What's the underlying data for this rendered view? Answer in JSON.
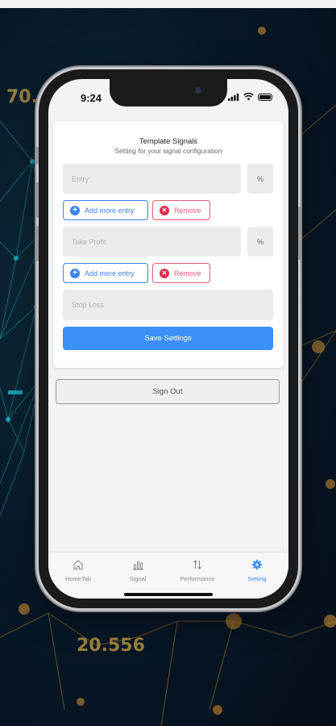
{
  "background": {
    "numbers": [
      "70.",
      "20.556"
    ]
  },
  "status_bar": {
    "time": "9:24"
  },
  "card": {
    "title": "Template Signals",
    "subtitle": "Setting for your signal configuration",
    "entry_placeholder": "Entry",
    "take_profit_placeholder": "Take Profit",
    "stop_loss_placeholder": "Stop Loss",
    "percent_label": "%",
    "add_more_entry_label": "Add more entry",
    "remove_label": "Remove",
    "save_label": "Save Settings"
  },
  "sign_out_label": "Sign Out",
  "tabbar": {
    "tabs": [
      {
        "label": "HomeTab",
        "icon": "home-icon",
        "active": false
      },
      {
        "label": "Signal",
        "icon": "bar-chart-icon",
        "active": false
      },
      {
        "label": "Performance",
        "icon": "arrows-up-down-icon",
        "active": false
      },
      {
        "label": "Setting",
        "icon": "gear-icon",
        "active": true
      }
    ]
  },
  "colors": {
    "accent": "#3b8ff6",
    "danger": "#e35b73",
    "screen_bg": "#f2f3f5"
  }
}
